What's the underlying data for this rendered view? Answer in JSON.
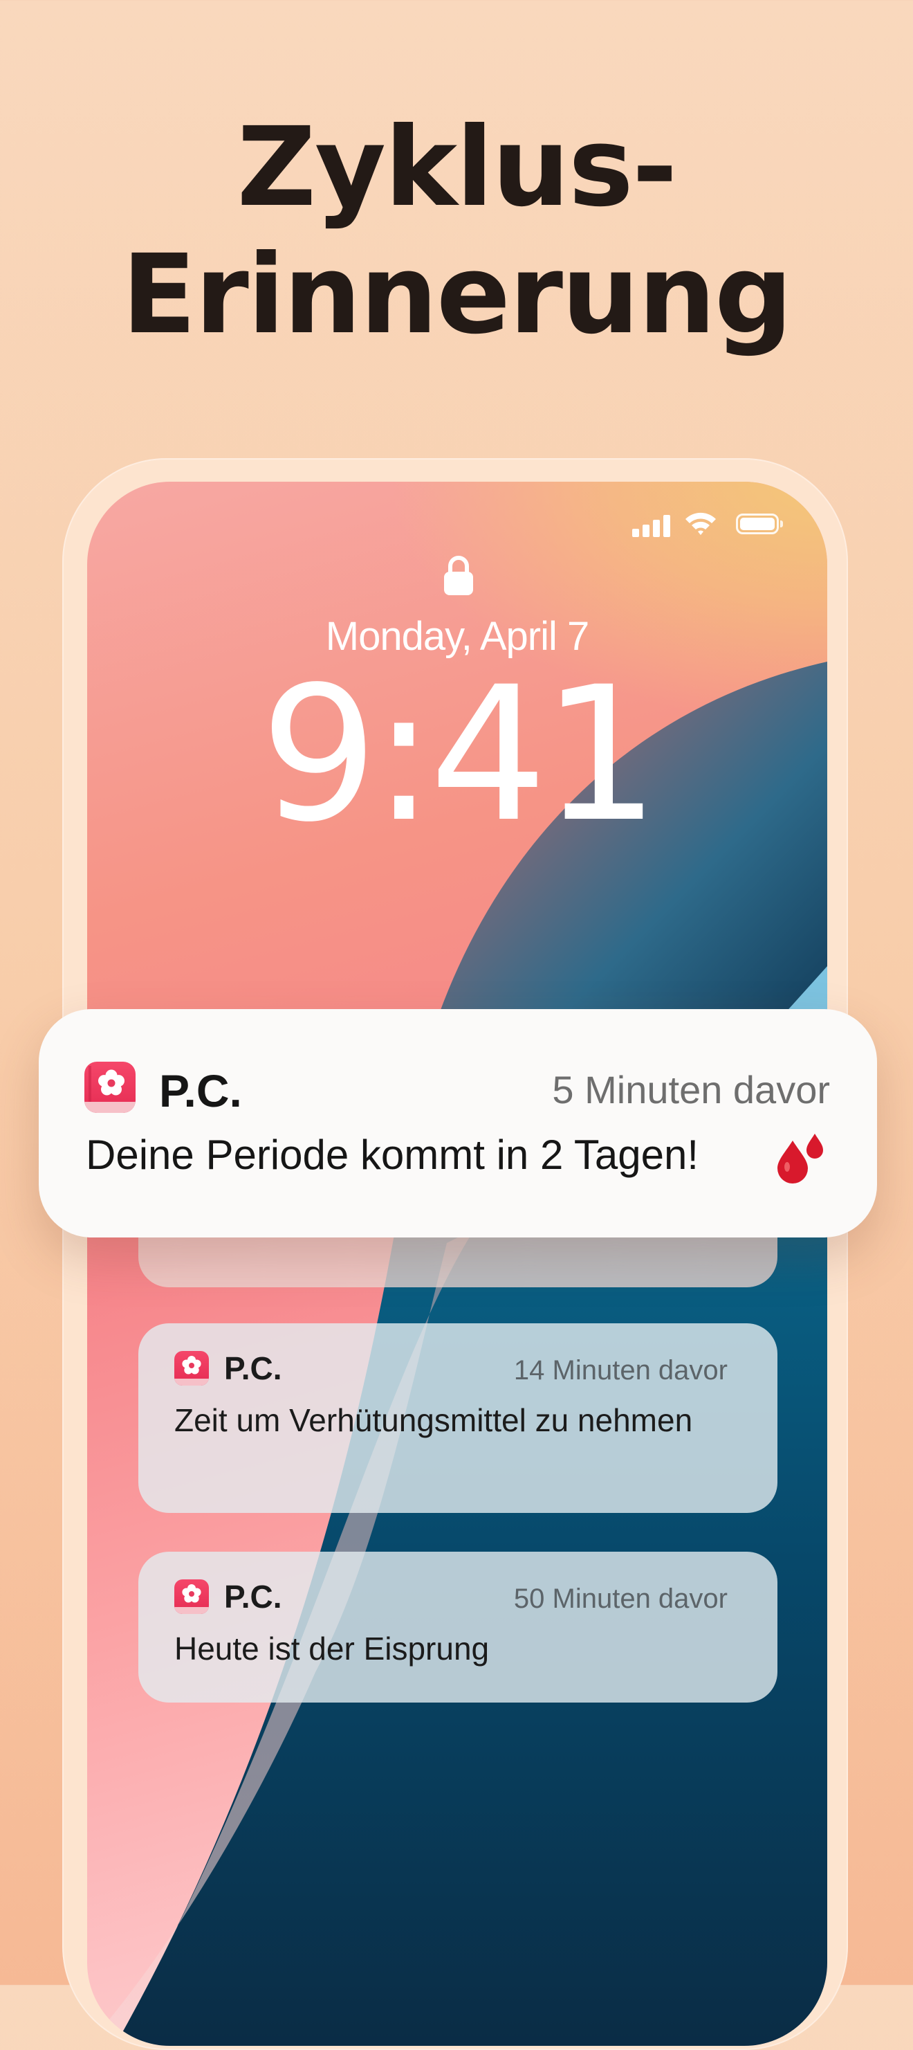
{
  "headline": {
    "line1": "Zyklus-",
    "line2": "Erinnerung"
  },
  "lockscreen": {
    "date": "Monday, April 7",
    "time": "9:41",
    "status_icons": [
      "cellular-signal-icon",
      "wifi-icon",
      "battery-icon"
    ],
    "lock_icon": "lock-icon"
  },
  "notifications": {
    "primary": {
      "app_name": "P.C.",
      "time": "5 Minuten davor",
      "message": "Deine Periode kommt in 2 Tagen!",
      "emoji_icon": "blood-drops-icon"
    },
    "items": [
      {
        "app_name": "P.C.",
        "time": "14 Minuten davor",
        "message": "Zeit um Verhütungsmittel zu nehmen"
      },
      {
        "app_name": "P.C.",
        "time": "50 Minuten davor",
        "message": "Heute ist der Eisprung"
      }
    ]
  },
  "colors": {
    "background": "#f8cdaa",
    "app_icon": "#e83a5e",
    "drop_red": "#d8192c"
  }
}
